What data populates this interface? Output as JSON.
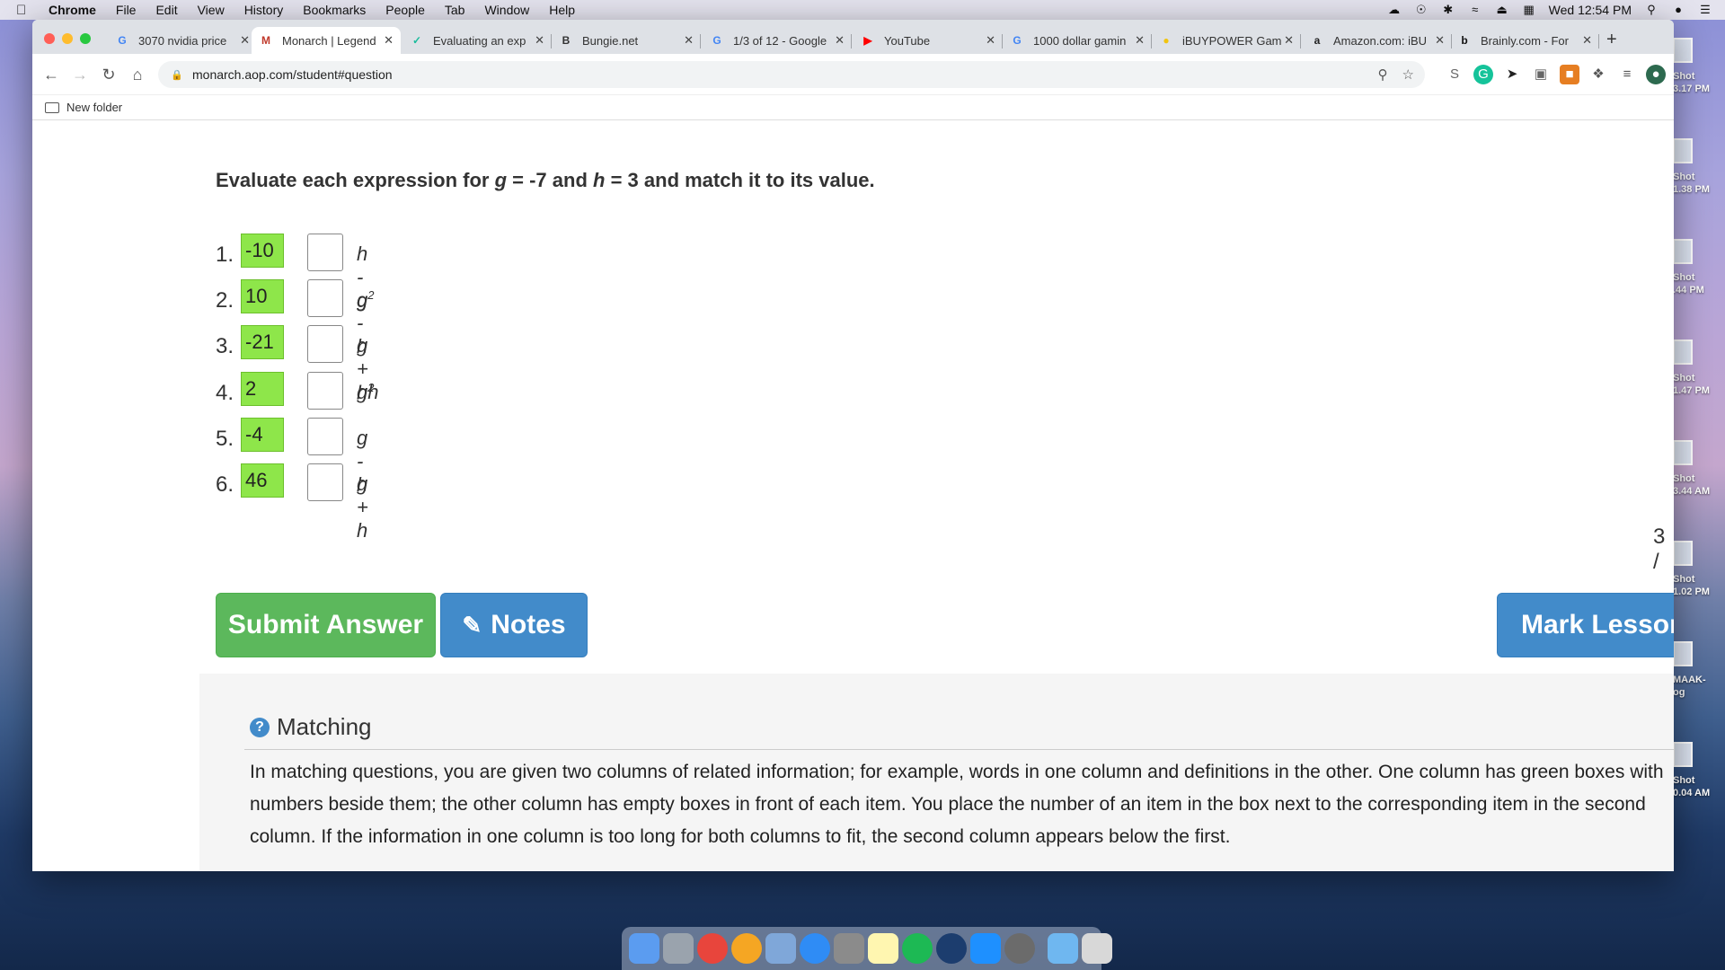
{
  "menubar": {
    "app": "Chrome",
    "items": [
      "File",
      "Edit",
      "View",
      "History",
      "Bookmarks",
      "People",
      "Tab",
      "Window",
      "Help"
    ],
    "clock": "Wed 12:54 PM"
  },
  "tabs": [
    {
      "label": "3070 nvidia price",
      "favicon": "G",
      "color": "#4285f4"
    },
    {
      "label": "Monarch | Legend",
      "favicon": "M",
      "color": "#c0392b"
    },
    {
      "label": "Evaluating an exp",
      "favicon": "✓",
      "color": "#1abc9c"
    },
    {
      "label": "Bungie.net",
      "favicon": "B",
      "color": "#333333"
    },
    {
      "label": "1/3 of 12 - Google",
      "favicon": "G",
      "color": "#4285f4"
    },
    {
      "label": "YouTube",
      "favicon": "▶",
      "color": "#ff0000"
    },
    {
      "label": "1000 dollar gamin",
      "favicon": "G",
      "color": "#4285f4"
    },
    {
      "label": "iBUYPOWER Gam",
      "favicon": "●",
      "color": "#f1c40f"
    },
    {
      "label": "Amazon.com: iBU",
      "favicon": "a",
      "color": "#222222"
    },
    {
      "label": "Brainly.com - For",
      "favicon": "b",
      "color": "#111111"
    }
  ],
  "address": {
    "url": "monarch.aop.com/student#question"
  },
  "bookmarks": {
    "folder": "New folder"
  },
  "question": {
    "prefix": "Evaluate each expression for ",
    "var1": "g",
    "mid1": " = -7 and ",
    "var2": "h",
    "suffix": " = 3 and match it to its value."
  },
  "rows": [
    {
      "num": "1.",
      "value": "-10",
      "expr_a": "h",
      "expr_b": " - g",
      "sup_pos": ""
    },
    {
      "num": "2.",
      "value": "10",
      "expr_a": "g",
      "expr_b": " - h",
      "sup_pos": "a"
    },
    {
      "num": "3.",
      "value": "-21",
      "expr_a": "g",
      "expr_b": " + h",
      "sup_pos": "b"
    },
    {
      "num": "4.",
      "value": "2",
      "expr_a": "gh",
      "expr_b": "",
      "sup_pos": ""
    },
    {
      "num": "5.",
      "value": "-4",
      "expr_a": "g",
      "expr_b": " - h",
      "sup_pos": ""
    },
    {
      "num": "6.",
      "value": "46",
      "expr_a": "g",
      "expr_b": " + h",
      "sup_pos": ""
    }
  ],
  "superscript": "2",
  "progress": "3 /",
  "buttons": {
    "submit": "Submit Answer",
    "notes": "Notes",
    "mark": "Mark Lesson"
  },
  "help": {
    "title": "Matching",
    "text": "In matching questions, you are given two columns of related information; for example, words in one column and definitions in the other. One column has green boxes with numbers beside them; the other column has empty boxes in front of each item. You place the number of an item in the box next to the corresponding item in the second column. If the information in one column is too long for both columns to fit, the second column appears below the first."
  },
  "desktop_items": [
    {
      "caption_1": "Shot",
      "caption_2": "3.17 PM"
    },
    {
      "caption_1": "Shot",
      "caption_2": "1.38 PM"
    },
    {
      "caption_1": "Shot",
      "caption_2": ".44 PM"
    },
    {
      "caption_1": "Shot",
      "caption_2": "1.47 PM"
    },
    {
      "caption_1": "Shot",
      "caption_2": "3.44 AM"
    },
    {
      "caption_1": "Shot",
      "caption_2": "1.02 PM"
    },
    {
      "caption_1": "MAAK-",
      "caption_2": "og"
    },
    {
      "caption_1": "Shot",
      "caption_2": "0.04 AM"
    }
  ],
  "colors": {
    "green_box": "#8ee64a",
    "submit_btn": "#5cb85c",
    "notes_btn": "#428bca"
  }
}
